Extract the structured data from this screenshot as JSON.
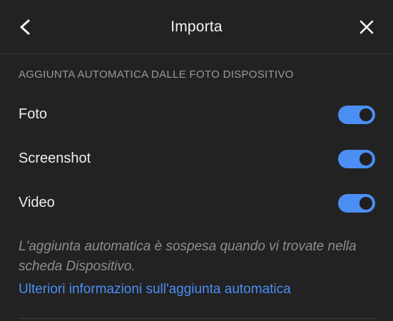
{
  "header": {
    "title": "Importa",
    "back_icon": "chevron-left-icon",
    "close_icon": "close-icon"
  },
  "section": {
    "title": "AGGIUNTA AUTOMATICA DALLE FOTO DISPOSITIVO",
    "items": [
      {
        "label": "Foto",
        "enabled": true
      },
      {
        "label": "Screenshot",
        "enabled": true
      },
      {
        "label": "Video",
        "enabled": true
      }
    ]
  },
  "note": "L'aggiunta automatica è sospesa quando vi trovate nella scheda Dispositivo.",
  "link": "Ulteriori informazioni sull'aggiunta automatica",
  "colors": {
    "background": "#222222",
    "accent": "#4b8ef4",
    "section_text": "#9a9a9a",
    "note_text": "#8e8e8e"
  }
}
